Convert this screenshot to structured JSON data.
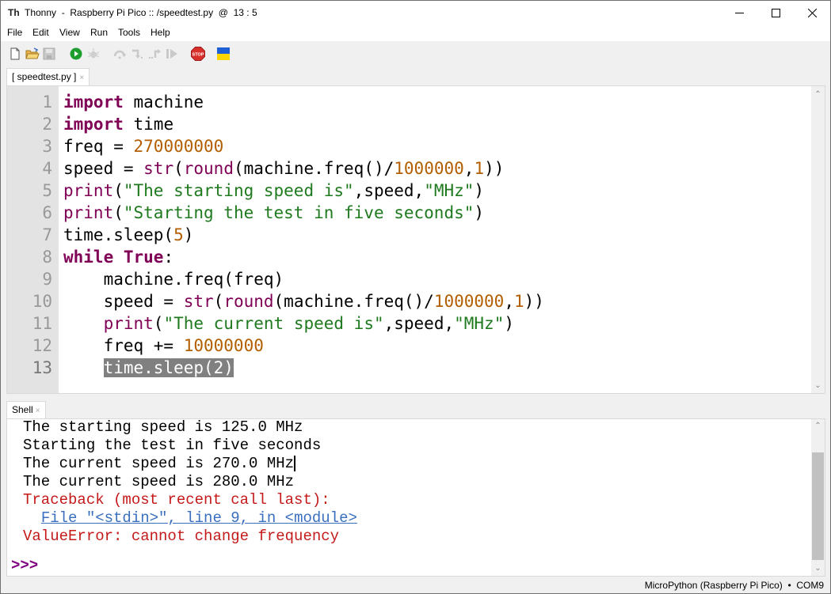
{
  "window": {
    "title": "Thonny  -  Raspberry Pi Pico :: /speedtest.py  @  13 : 5",
    "app_icon": "thonny-logo-icon",
    "controls": {
      "minimize": "minimize-icon",
      "maximize": "maximize-icon",
      "close": "close-icon"
    }
  },
  "menubar": {
    "items": [
      {
        "label": "File"
      },
      {
        "label": "Edit"
      },
      {
        "label": "View"
      },
      {
        "label": "Run"
      },
      {
        "label": "Tools"
      },
      {
        "label": "Help"
      }
    ]
  },
  "toolbar": {
    "buttons": [
      {
        "name": "new-file",
        "icon": "new-file-icon",
        "enabled": true
      },
      {
        "name": "open-file",
        "icon": "open-folder-icon",
        "enabled": true
      },
      {
        "name": "save-file",
        "icon": "save-icon",
        "enabled": false
      },
      {
        "name": "run",
        "icon": "run-icon",
        "enabled": true,
        "color": "#1e9e2e"
      },
      {
        "name": "debug",
        "icon": "debug-bug-icon",
        "enabled": false
      },
      {
        "name": "step-over",
        "icon": "step-over-icon",
        "enabled": false
      },
      {
        "name": "step-into",
        "icon": "step-into-icon",
        "enabled": false
      },
      {
        "name": "step-out",
        "icon": "step-out-icon",
        "enabled": false
      },
      {
        "name": "resume",
        "icon": "resume-icon",
        "enabled": false
      },
      {
        "name": "stop",
        "icon": "stop-sign-icon",
        "enabled": true,
        "label": "STOP",
        "color": "#d9302c"
      },
      {
        "name": "ukraine-flag",
        "icon": "ukraine-flag-icon",
        "enabled": true,
        "colors": [
          "#1f5fd6",
          "#ffd500"
        ]
      }
    ]
  },
  "editor": {
    "tab_label": "[ speedtest.py ]",
    "tab_close": "×",
    "cursor": "13 : 5",
    "lines": [
      {
        "n": "1",
        "tokens": [
          [
            "kw",
            "import"
          ],
          [
            "",
            "machine"
          ]
        ]
      },
      {
        "n": "2",
        "tokens": [
          [
            "kw",
            "import"
          ],
          [
            "",
            "time"
          ]
        ]
      },
      {
        "n": "3",
        "tokens": [
          [
            "",
            "freq = "
          ],
          [
            "num",
            "270000000"
          ]
        ]
      },
      {
        "n": "4",
        "tokens": [
          [
            "",
            "speed = "
          ],
          [
            "bi",
            "str"
          ],
          [
            "",
            "("
          ],
          [
            "bi",
            "round"
          ],
          [
            "",
            "(machine.freq()/"
          ],
          [
            "num",
            "1000000"
          ],
          [
            "",
            ","
          ],
          [
            "num",
            "1"
          ],
          [
            "",
            "))"
          ]
        ]
      },
      {
        "n": "5",
        "tokens": [
          [
            "bi",
            "print"
          ],
          [
            "",
            "("
          ],
          [
            "str",
            "\"The starting speed is\""
          ],
          [
            "",
            ",speed,"
          ],
          [
            "str",
            "\"MHz\""
          ],
          [
            "",
            ")"
          ]
        ]
      },
      {
        "n": "6",
        "tokens": [
          [
            "bi",
            "print"
          ],
          [
            "",
            "("
          ],
          [
            "str",
            "\"Starting the test in five seconds\""
          ],
          [
            "",
            ")"
          ]
        ]
      },
      {
        "n": "7",
        "tokens": [
          [
            "",
            "time.sleep("
          ],
          [
            "num",
            "5"
          ],
          [
            "",
            ")"
          ]
        ]
      },
      {
        "n": "8",
        "tokens": [
          [
            "kw",
            "while"
          ],
          [
            "",
            ""
          ],
          [
            "kw",
            "True"
          ],
          [
            "",
            ":"
          ]
        ]
      },
      {
        "n": "9",
        "tokens": [
          [
            "",
            "    machine.freq(freq)"
          ]
        ]
      },
      {
        "n": "10",
        "tokens": [
          [
            "",
            "    speed = "
          ],
          [
            "bi",
            "str"
          ],
          [
            "",
            "("
          ],
          [
            "bi",
            "round"
          ],
          [
            "",
            "(machine.freq()/"
          ],
          [
            "num",
            "1000000"
          ],
          [
            "",
            ","
          ],
          [
            "num",
            "1"
          ],
          [
            "",
            "))"
          ]
        ]
      },
      {
        "n": "11",
        "tokens": [
          [
            "",
            "    "
          ],
          [
            "bi",
            "print"
          ],
          [
            "",
            "("
          ],
          [
            "str",
            "\"The current speed is\""
          ],
          [
            "",
            ",speed,"
          ],
          [
            "str",
            "\"MHz\""
          ],
          [
            "",
            ")"
          ]
        ]
      },
      {
        "n": "12",
        "tokens": [
          [
            "",
            "    freq += "
          ],
          [
            "num",
            "10000000"
          ]
        ]
      },
      {
        "n": "13",
        "tokens": [
          [
            "",
            "    "
          ],
          [
            "sel",
            "time.sleep(2)"
          ]
        ]
      }
    ]
  },
  "shell": {
    "tab_label": "Shell",
    "tab_close": "×",
    "lines": [
      {
        "type": "out",
        "text": "The starting speed is 125.0 MHz"
      },
      {
        "type": "out",
        "text": "Starting the test in five seconds"
      },
      {
        "type": "out-caret",
        "text": "The current speed is 270.0 MHz"
      },
      {
        "type": "out",
        "text": "The current speed is 280.0 MHz"
      },
      {
        "type": "err",
        "text": "Traceback (most recent call last):"
      },
      {
        "type": "link",
        "text": "  File \"<stdin>\", line 9, in <module>"
      },
      {
        "type": "err",
        "text": "ValueError: cannot change frequency"
      }
    ],
    "prompt": ">>>"
  },
  "statusbar": {
    "text": "MicroPython (Raspberry Pi Pico)  •  COM9"
  },
  "colors": {
    "keyword": "#7f0055",
    "number": "#b35e00",
    "string": "#1f7a1f",
    "error": "#c41a1a",
    "link": "#3a6fbf",
    "prompt": "#7f007f",
    "selection": "#808080"
  }
}
